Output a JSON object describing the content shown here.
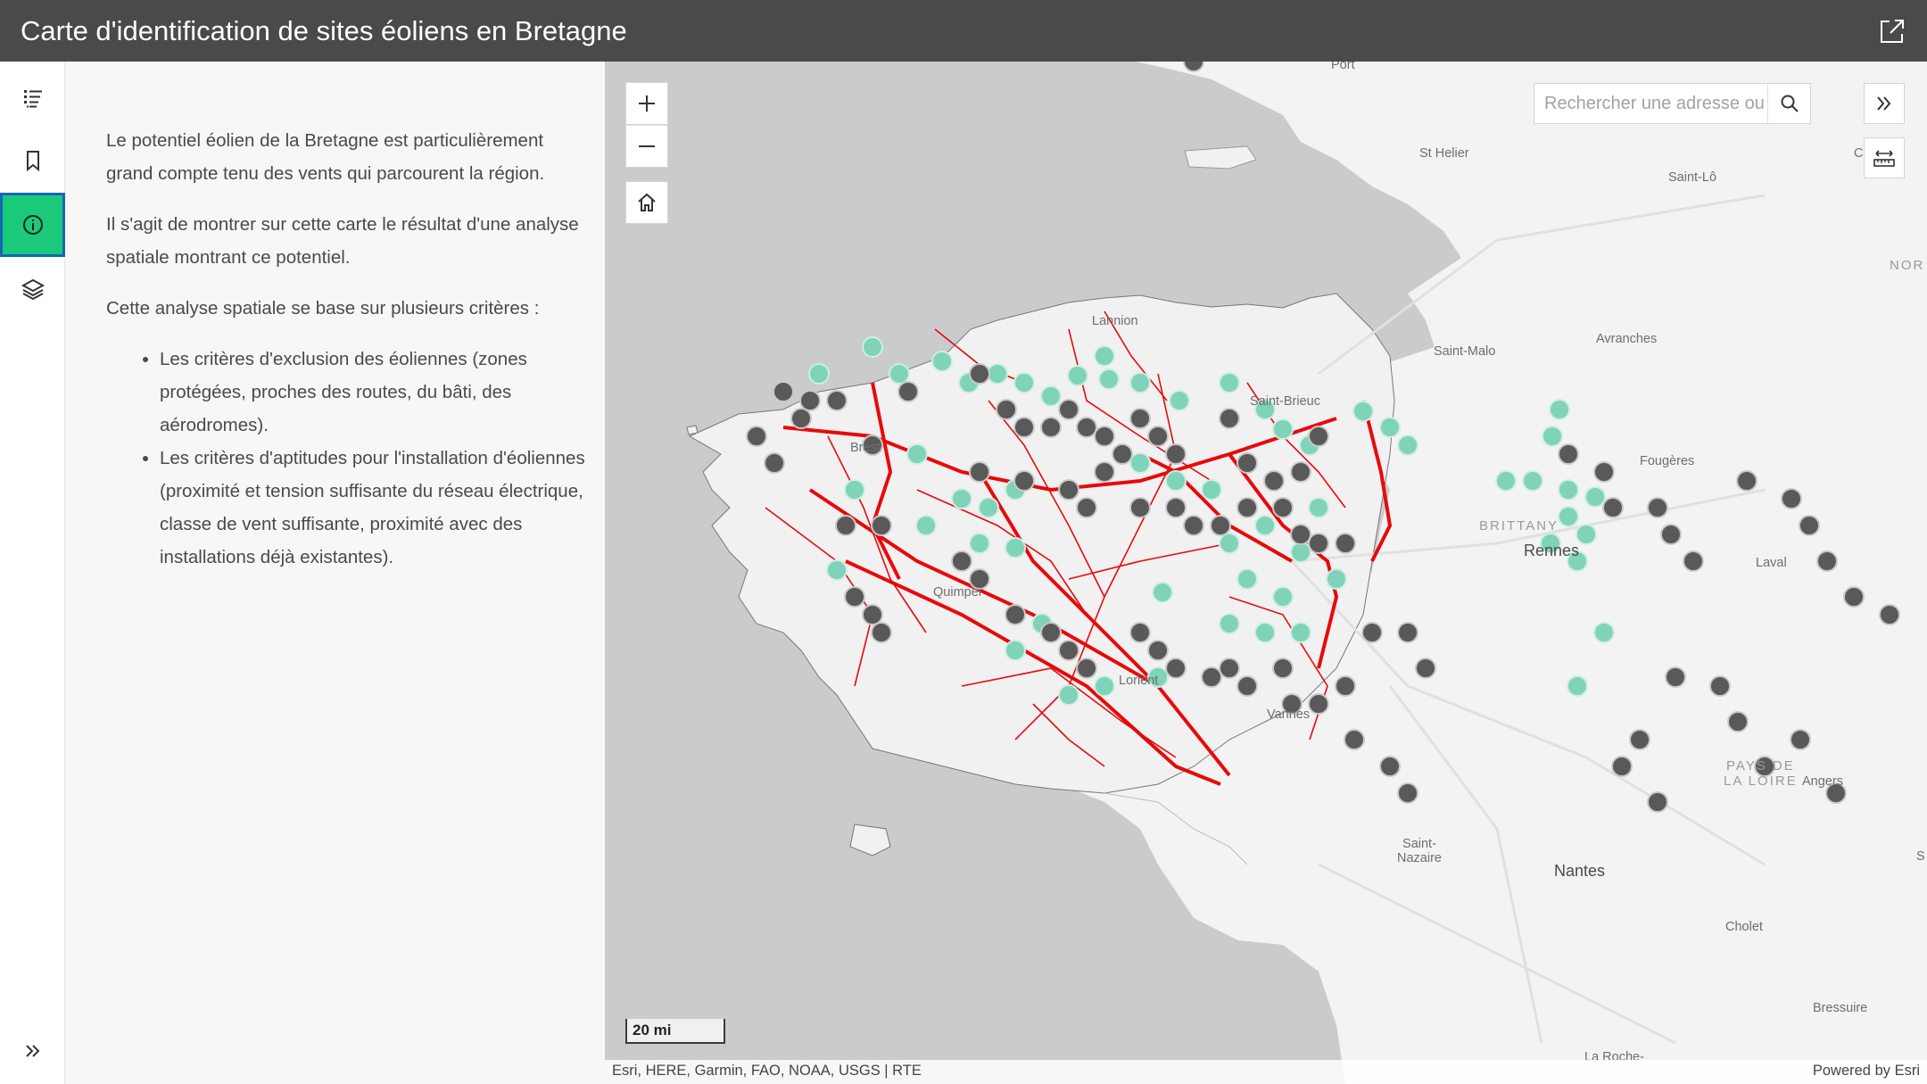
{
  "header": {
    "title": "Carte d'identification de sites éoliens en Bretagne",
    "share_icon": "share-icon"
  },
  "rail": {
    "items": [
      {
        "icon": "legend-icon"
      },
      {
        "icon": "bookmark-icon"
      },
      {
        "icon": "info-icon",
        "active": true
      },
      {
        "icon": "layers-icon"
      }
    ],
    "expand_icon": "chevrons-right-icon"
  },
  "panel": {
    "para1": "Le potentiel éolien de la Bretagne est particulièrement grand compte tenu des vents qui parcourent la région.",
    "para2": "Il s'agit de montrer sur cette carte le résultat d'une analyse spatiale montrant ce potentiel.",
    "para3": "Cette analyse spatiale se base sur plusieurs critères :",
    "criteria": [
      "Les critères d'exclusion des éoliennes (zones protégées, proches des routes, du bâti, des aérodromes).",
      "Les critères d'aptitudes pour l'installation d'éoliennes (proximité et tension suffisante du réseau électrique, classe de vent suffisante, proximité avec des installations déjà existantes)."
    ]
  },
  "map": {
    "search_placeholder": "Rechercher une adresse ou un",
    "scale_label": "20 mi",
    "attribution": "Esri, HERE, Garmin, FAO, NOAA, USGS | RTE",
    "powered_by": "Powered by Esri",
    "colors": {
      "water": "#c9cbcc",
      "land": "#f3f3f3",
      "grid_lines": "#e8090b",
      "site_suitable": "#7fd3b8",
      "site_existing": "#595959"
    },
    "labels": {
      "port": "Port",
      "st_helier": "St Helier",
      "saint_lo": "Saint-Lô",
      "c_edge": "C",
      "nor": "NOR",
      "avranches": "Avranches",
      "lannion": "Lannion",
      "saint_malo": "Saint-Malo",
      "saint_brieuc": "Saint-Brieuc",
      "brest": "Brest",
      "fougeres": "Fougères",
      "brittany": "BRITTANY",
      "rennes": "Rennes",
      "laval": "Laval",
      "quimper": "Quimper",
      "lorient": "Lorient",
      "vannes": "Vannes",
      "pays_de_la_loire": "PAYS DE\nLA LOIRE",
      "angers": "Angers",
      "saint_nazaire": "Saint-\nNazaire",
      "nantes": "Nantes",
      "cholet": "Cholet",
      "bressuire": "Bressuire",
      "la_roche": "La Roche-",
      "s_edge": "S"
    }
  }
}
